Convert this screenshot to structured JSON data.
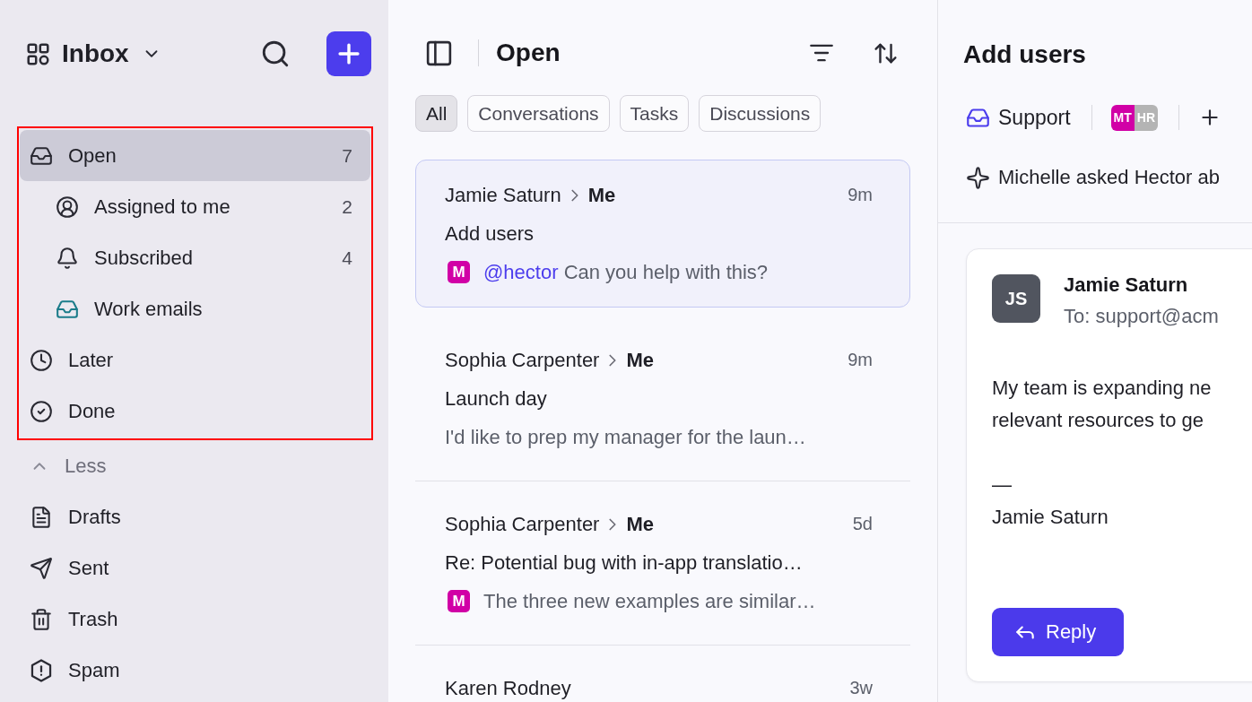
{
  "sidebar": {
    "title": "Inbox",
    "highlighted": true,
    "items": [
      {
        "label": "Open",
        "count": "7",
        "selected": true,
        "children": [
          {
            "label": "Assigned to me",
            "count": "2",
            "selected": false
          },
          {
            "label": "Subscribed",
            "count": "4",
            "selected": false
          },
          {
            "label": "Work emails",
            "selected": false,
            "color": "#1b7c8a"
          }
        ]
      },
      {
        "label": "Later",
        "selected": false
      },
      {
        "label": "Done",
        "selected": false
      }
    ],
    "toggle": {
      "label": "Less",
      "expanded": true
    },
    "more_items": [
      {
        "label": "Drafts",
        "selected": false
      },
      {
        "label": "Sent",
        "selected": false
      },
      {
        "label": "Trash",
        "selected": false
      },
      {
        "label": "Spam",
        "selected": false
      }
    ]
  },
  "conversation_list": {
    "title": "Open",
    "filters": [
      {
        "label": "All",
        "selected": true
      },
      {
        "label": "Conversations",
        "selected": false
      },
      {
        "label": "Tasks",
        "selected": false
      },
      {
        "label": "Discussions",
        "selected": false
      }
    ],
    "conversations": [
      {
        "sender": "Jamie Saturn",
        "recipient": "Me",
        "time": "9m",
        "subject": "Add users",
        "badge": "M",
        "mention": "@hector",
        "preview": "Can you help with this?",
        "selected": true
      },
      {
        "sender": "Sophia Carpenter",
        "recipient": "Me",
        "time": "9m",
        "subject": "Launch day",
        "preview": "I'd like to prep my manager for the laun…",
        "selected": false
      },
      {
        "sender": "Sophia Carpenter",
        "recipient": "Me",
        "time": "5d",
        "subject": "Re: Potential bug with in-app translatio…",
        "badge": "M",
        "preview": "The three new examples are similar…",
        "selected": false
      },
      {
        "sender": "Karen Rodney",
        "time": "3w",
        "selected": false
      }
    ]
  },
  "detail": {
    "title": "Add users",
    "inbox": "Support",
    "assignees": [
      {
        "initials": "MT",
        "color": "#d100a6"
      },
      {
        "initials": "HR",
        "color": "#b4b4b4"
      }
    ],
    "summary": "Michelle asked Hector ab",
    "message": {
      "avatar": "JS",
      "sender": "Jamie Saturn",
      "to": "To: support@acm",
      "body": [
        "My team is expanding ne",
        "relevant resources to ge"
      ],
      "signature": [
        "—",
        "Jamie Saturn"
      ],
      "reply_button": "Reply"
    }
  }
}
